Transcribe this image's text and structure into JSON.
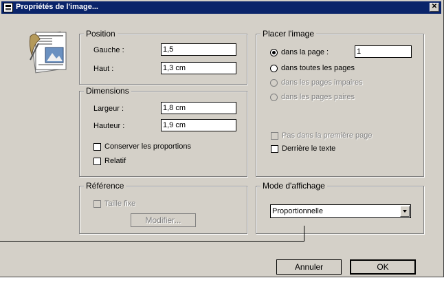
{
  "window": {
    "title": "Propriétés de l'image..."
  },
  "position": {
    "legend": "Position",
    "gauche_label": "Gauche :",
    "gauche_value": "1,5",
    "haut_label": "Haut :",
    "haut_value": "1,3 cm"
  },
  "dimensions": {
    "legend": "Dimensions",
    "largeur_label": "Largeur :",
    "largeur_value": "1,8 cm",
    "hauteur_label": "Hauteur :",
    "hauteur_value": "1,9 cm",
    "conserver_label": "Conserver les proportions",
    "relatif_label": "Relatif"
  },
  "reference": {
    "legend": "Référence",
    "taille_fixe_label": "Taille fixe",
    "modifier_label": "Modifier..."
  },
  "placer": {
    "legend": "Placer l'image",
    "dans_page_label": "dans la page :",
    "dans_page_value": "1",
    "toutes_pages_label": "dans toutes les pages",
    "pages_impaires_label": "dans les pages impaires",
    "pages_paires_label": "dans les pages paires",
    "pas_premiere_label": "Pas dans la première page",
    "derriere_texte_label": "Derrière le texte"
  },
  "affichage": {
    "legend": "Mode d'affichage",
    "selected": "Proportionnelle"
  },
  "buttons": {
    "annuler": "Annuler",
    "ok": "OK"
  },
  "icons": {
    "title": "image-properties-icon",
    "close": "close-icon",
    "document": "document-image-icon"
  }
}
